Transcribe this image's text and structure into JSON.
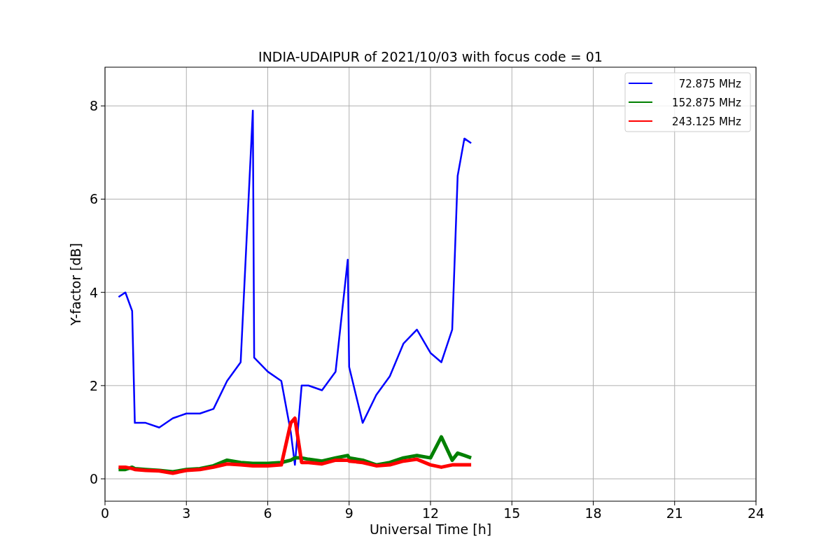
{
  "figure": {
    "chart_data": {
      "type": "line",
      "title": "INDIA-UDAIPUR of 2021/10/03 with focus code = 01",
      "xlabel": "Universal Time [h]",
      "ylabel": "Y-factor [dB]",
      "x": [
        0.5,
        0.75,
        1.0,
        1.1,
        1.5,
        2.0,
        2.5,
        3.0,
        3.5,
        4.0,
        4.5,
        5.0,
        5.45,
        5.5,
        6.0,
        6.5,
        6.85,
        7.0,
        7.25,
        7.5,
        8.0,
        8.5,
        8.95,
        9.0,
        9.5,
        10.0,
        10.5,
        11.0,
        11.5,
        12.0,
        12.4,
        12.8,
        13.0,
        13.25,
        13.5
      ],
      "series": [
        {
          "name": "72.875 MHz",
          "color": "#0000ff",
          "values": [
            3.9,
            4.0,
            3.6,
            1.2,
            1.2,
            1.1,
            1.3,
            1.4,
            1.4,
            1.5,
            2.1,
            2.5,
            7.9,
            2.6,
            2.3,
            2.1,
            1.0,
            0.3,
            2.0,
            2.0,
            1.9,
            2.3,
            4.7,
            2.4,
            1.2,
            1.8,
            2.2,
            2.9,
            3.2,
            2.7,
            2.5,
            3.2,
            6.5,
            7.3,
            7.2
          ]
        },
        {
          "name": "152.875 MHz",
          "color": "#008000",
          "values": [
            0.2,
            0.2,
            0.25,
            0.22,
            0.2,
            0.18,
            0.15,
            0.2,
            0.22,
            0.28,
            0.4,
            0.35,
            0.33,
            0.33,
            0.33,
            0.35,
            0.4,
            0.45,
            0.45,
            0.42,
            0.38,
            0.45,
            0.5,
            0.45,
            0.4,
            0.3,
            0.35,
            0.45,
            0.5,
            0.45,
            0.9,
            0.4,
            0.55,
            0.5,
            0.45
          ]
        },
        {
          "name": "243.125 MHz",
          "color": "#ff0000",
          "values": [
            0.25,
            0.25,
            0.22,
            0.2,
            0.18,
            0.17,
            0.12,
            0.18,
            0.2,
            0.25,
            0.32,
            0.3,
            0.28,
            0.28,
            0.28,
            0.3,
            1.2,
            1.3,
            0.35,
            0.35,
            0.32,
            0.4,
            0.4,
            0.38,
            0.35,
            0.28,
            0.3,
            0.38,
            0.42,
            0.3,
            0.25,
            0.3,
            0.3,
            0.3,
            0.3
          ]
        }
      ],
      "xlim": [
        0,
        24
      ],
      "ylim": [
        -0.48,
        8.83
      ],
      "xticks": [
        0,
        3,
        6,
        9,
        12,
        15,
        18,
        21,
        24
      ],
      "yticks": [
        0,
        2,
        4,
        6,
        8
      ],
      "grid": true,
      "legend": true
    }
  }
}
